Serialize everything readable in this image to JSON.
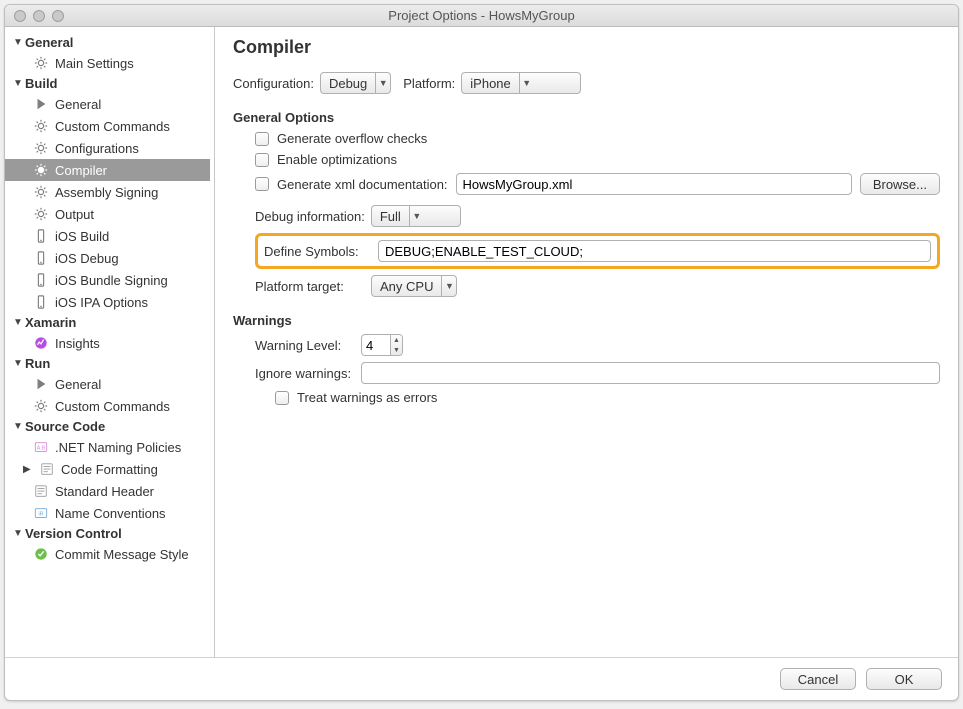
{
  "window": {
    "title": "Project Options - HowsMyGroup"
  },
  "sidebar": {
    "general": {
      "label": "General",
      "items": [
        {
          "label": "Main Settings",
          "icon": "gear"
        }
      ]
    },
    "build": {
      "label": "Build",
      "items": [
        {
          "label": "General",
          "icon": "play"
        },
        {
          "label": "Custom Commands",
          "icon": "gear"
        },
        {
          "label": "Configurations",
          "icon": "gear"
        },
        {
          "label": "Compiler",
          "icon": "gear",
          "selected": true
        },
        {
          "label": "Assembly Signing",
          "icon": "gear"
        },
        {
          "label": "Output",
          "icon": "gear"
        },
        {
          "label": "iOS Build",
          "icon": "device"
        },
        {
          "label": "iOS Debug",
          "icon": "device"
        },
        {
          "label": "iOS Bundle Signing",
          "icon": "device"
        },
        {
          "label": "iOS IPA Options",
          "icon": "device"
        }
      ]
    },
    "xamarin": {
      "label": "Xamarin",
      "items": [
        {
          "label": "Insights",
          "icon": "insights"
        }
      ]
    },
    "run": {
      "label": "Run",
      "items": [
        {
          "label": "General",
          "icon": "play"
        },
        {
          "label": "Custom Commands",
          "icon": "gear"
        }
      ]
    },
    "source": {
      "label": "Source Code",
      "items": [
        {
          "label": ".NET Naming Policies",
          "icon": "badge-pink"
        },
        {
          "label": "Code Formatting",
          "icon": "lines",
          "expandable": true
        },
        {
          "label": "Standard Header",
          "icon": "lines"
        },
        {
          "label": "Name Conventions",
          "icon": "badge-blue"
        }
      ]
    },
    "version": {
      "label": "Version Control",
      "items": [
        {
          "label": "Commit Message Style",
          "icon": "check"
        }
      ]
    }
  },
  "page": {
    "title": "Compiler",
    "config_label": "Configuration:",
    "config_value": "Debug",
    "platform_label": "Platform:",
    "platform_value": "iPhone",
    "general_options_head": "General Options",
    "chk_overflow": "Generate overflow checks",
    "chk_optim": "Enable optimizations",
    "chk_xmldoc": "Generate xml documentation:",
    "xmldoc_value": "HowsMyGroup.xml",
    "browse_btn": "Browse...",
    "debug_info_label": "Debug information:",
    "debug_info_value": "Full",
    "define_label": "Define Symbols:",
    "define_value": "DEBUG;ENABLE_TEST_CLOUD;",
    "platform_target_label": "Platform target:",
    "platform_target_value": "Any CPU",
    "warnings_head": "Warnings",
    "warning_level_label": "Warning Level:",
    "warning_level_value": "4",
    "ignore_warnings_label": "Ignore warnings:",
    "ignore_warnings_value": "",
    "treat_warnings": "Treat warnings as errors"
  },
  "footer": {
    "cancel": "Cancel",
    "ok": "OK"
  }
}
